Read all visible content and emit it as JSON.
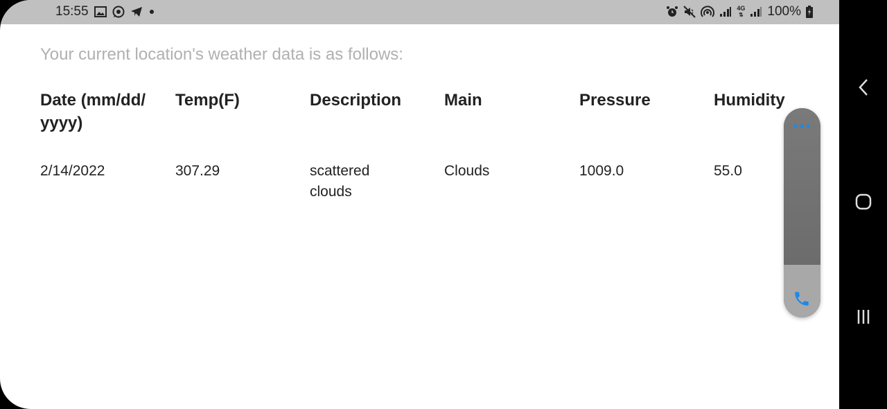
{
  "status_bar": {
    "time": "15:55",
    "battery": "100%",
    "left_icons": [
      "gallery-icon",
      "whatsapp-icon",
      "telegram-icon",
      "dot-icon"
    ],
    "right_icons": [
      "alarm-icon",
      "mute-icon",
      "hotspot-icon",
      "signal-icon",
      "4g-icon",
      "signal2-icon",
      "battery-icon"
    ],
    "network_label": "4G"
  },
  "main": {
    "subtitle": "Your current location's weather data is as follows:",
    "columns": [
      "Date (mm/dd/ yyyy)",
      "Temp(F)",
      "Description",
      "Main",
      "Pressure",
      "Humidity"
    ],
    "rows": [
      [
        "2/14/2022",
        "307.29",
        "scattered clouds",
        "Clouds",
        "1009.0",
        "55.0"
      ]
    ]
  },
  "floating_panel": {
    "top_icon": "more-dots-icon",
    "bottom_icon": "phone-icon",
    "accent_color": "#1e88e5"
  },
  "nav_bar": {
    "buttons": [
      "back-icon",
      "home-icon",
      "recents-icon"
    ]
  }
}
